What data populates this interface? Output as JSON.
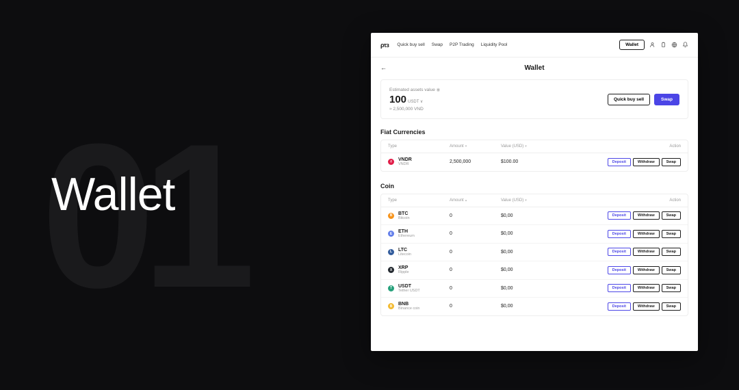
{
  "presentation": {
    "bg_number": "01",
    "hero": "Wallet"
  },
  "header": {
    "logo": "ρτз",
    "nav": [
      "Quick buy sell",
      "Swap",
      "P2P Trading",
      "Liquidity Pool"
    ],
    "wallet_button": "Wallet"
  },
  "page": {
    "title": "Wallet"
  },
  "summary": {
    "label": "Estimated assets value",
    "value": "100",
    "unit": "USDT ∨",
    "sub": "≈ 2,500,000 VND",
    "quick_buy_sell": "Quick buy sell",
    "swap": "Swap"
  },
  "tables": {
    "headers": {
      "type": "Type",
      "amount": "Amount",
      "value": "Value (USD)",
      "action": "Action"
    },
    "row_buttons": {
      "deposit": "Deposit",
      "withdraw": "Withdraw",
      "swap": "Swap"
    }
  },
  "fiat": {
    "title": "Fiat Currencies",
    "rows": [
      {
        "sym": "VNDR",
        "name": "VNDR",
        "amount": "2,500,000",
        "value": "$100.00",
        "color": "#e11d48",
        "glyph": "₫"
      }
    ]
  },
  "coin": {
    "title": "Coin",
    "rows": [
      {
        "sym": "BTC",
        "name": "Bitcoin",
        "amount": "0",
        "value": "$0,00",
        "color": "#f7931a",
        "glyph": "B"
      },
      {
        "sym": "ETH",
        "name": "Ethereum",
        "amount": "0",
        "value": "$0,00",
        "color": "#627eea",
        "glyph": "E"
      },
      {
        "sym": "LTC",
        "name": "Litecoin",
        "amount": "0",
        "value": "$0,00",
        "color": "#345d9d",
        "glyph": "L"
      },
      {
        "sym": "XRP",
        "name": "Ripple",
        "amount": "0",
        "value": "$0,00",
        "color": "#23292f",
        "glyph": "X"
      },
      {
        "sym": "USDT",
        "name": "Tether USDT",
        "amount": "0",
        "value": "$0,00",
        "color": "#26a17b",
        "glyph": "T"
      },
      {
        "sym": "BNB",
        "name": "Binance coin",
        "amount": "0",
        "value": "$0,00",
        "color": "#f3ba2f",
        "glyph": "B"
      }
    ]
  }
}
